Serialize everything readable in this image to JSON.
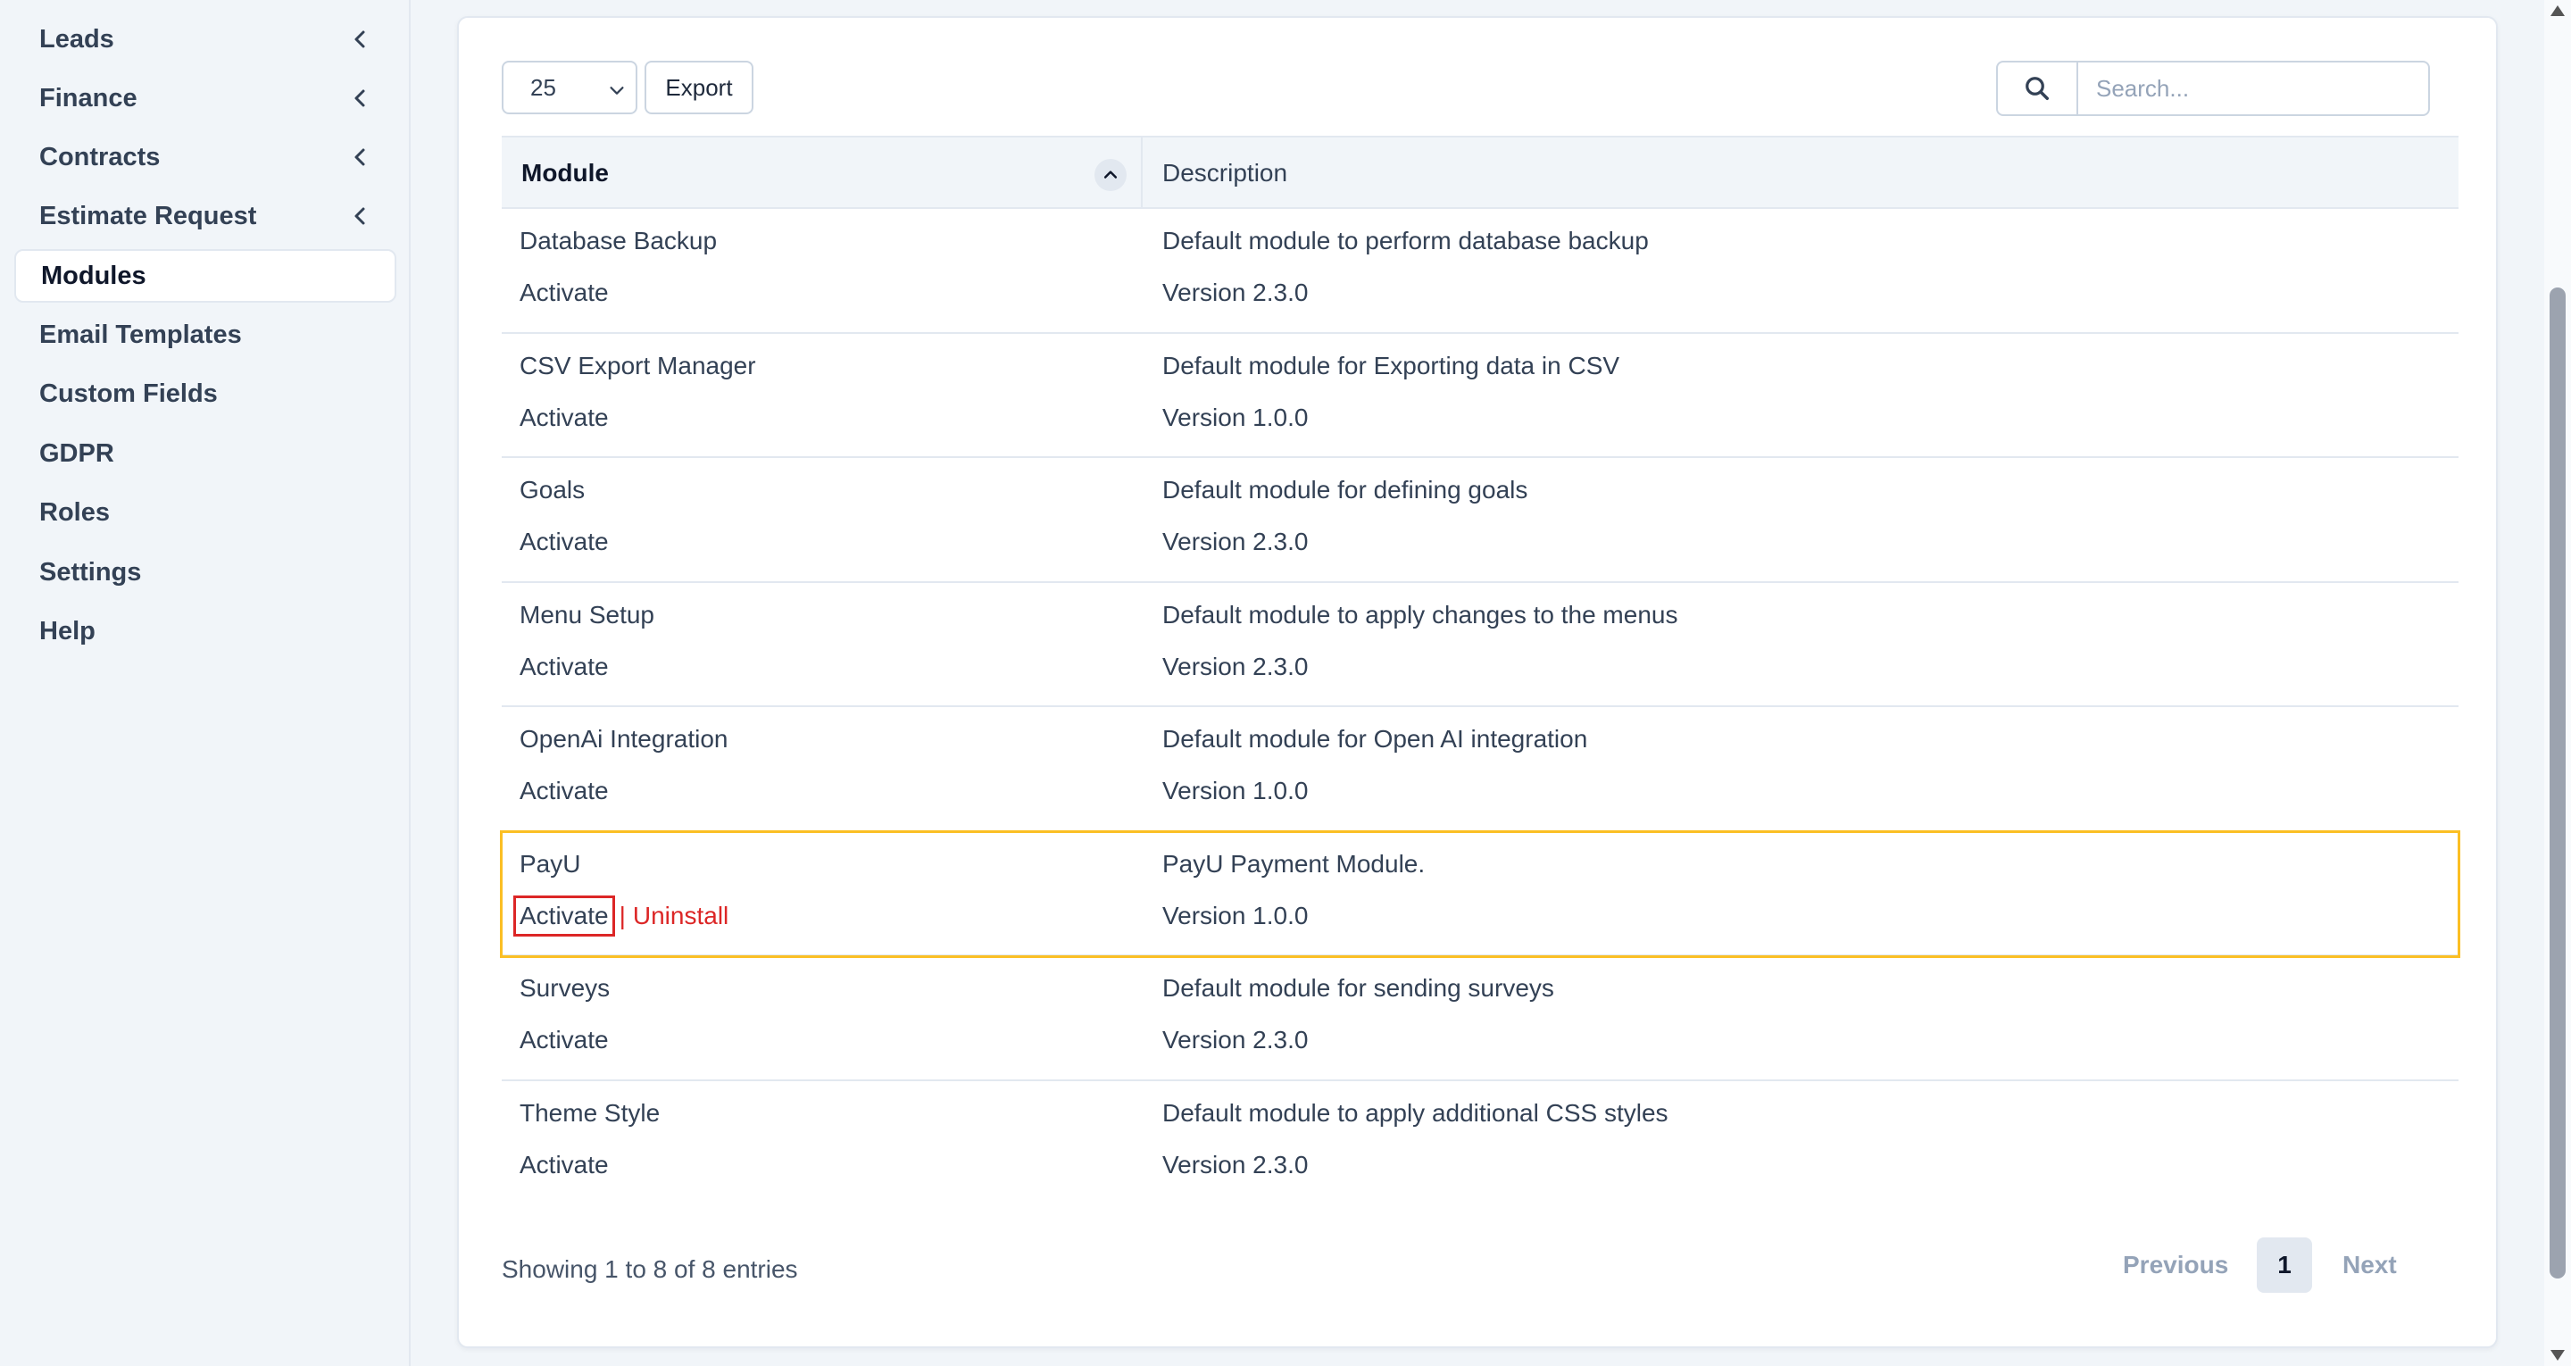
{
  "sidebar": {
    "items": [
      {
        "label": "Leads",
        "chevron": true
      },
      {
        "label": "Finance",
        "chevron": true
      },
      {
        "label": "Contracts",
        "chevron": true
      },
      {
        "label": "Estimate Request",
        "chevron": true
      },
      {
        "label": "Modules",
        "active": true
      },
      {
        "label": "Email Templates"
      },
      {
        "label": "Custom Fields"
      },
      {
        "label": "GDPR"
      },
      {
        "label": "Roles"
      },
      {
        "label": "Settings"
      },
      {
        "label": "Help"
      }
    ]
  },
  "toolbar": {
    "per_page": "25",
    "export_label": "Export",
    "search_placeholder": "Search..."
  },
  "table": {
    "headers": {
      "module": "Module",
      "description": "Description"
    },
    "rows": [
      {
        "name": "Database Backup",
        "action": "Activate",
        "description": "Default module to perform database backup",
        "version": "Version 2.3.0"
      },
      {
        "name": "CSV Export Manager",
        "action": "Activate",
        "description": "Default module for Exporting data in CSV",
        "version": "Version 1.0.0"
      },
      {
        "name": "Goals",
        "action": "Activate",
        "description": "Default module for defining goals",
        "version": "Version 2.3.0"
      },
      {
        "name": "Menu Setup",
        "action": "Activate",
        "description": "Default module to apply changes to the menus",
        "version": "Version 2.3.0"
      },
      {
        "name": "OpenAi Integration",
        "action": "Activate",
        "description": "Default module for Open AI integration",
        "version": "Version 1.0.0"
      },
      {
        "name": "PayU",
        "action": "Activate",
        "uninstall": "Uninstall",
        "separator": "|",
        "description": "PayU Payment Module.",
        "version": "Version 1.0.0"
      },
      {
        "name": "Surveys",
        "action": "Activate",
        "description": "Default module for sending surveys",
        "version": "Version 2.3.0"
      },
      {
        "name": "Theme Style",
        "action": "Activate",
        "description": "Default module to apply additional CSS styles",
        "version": "Version 2.3.0"
      }
    ]
  },
  "footer": {
    "info": "Showing 1 to 8 of 8 entries",
    "previous": "Previous",
    "page": "1",
    "next": "Next"
  },
  "colors": {
    "accent_danger": "#dc2626",
    "row_highlight": "#fbbf24"
  }
}
